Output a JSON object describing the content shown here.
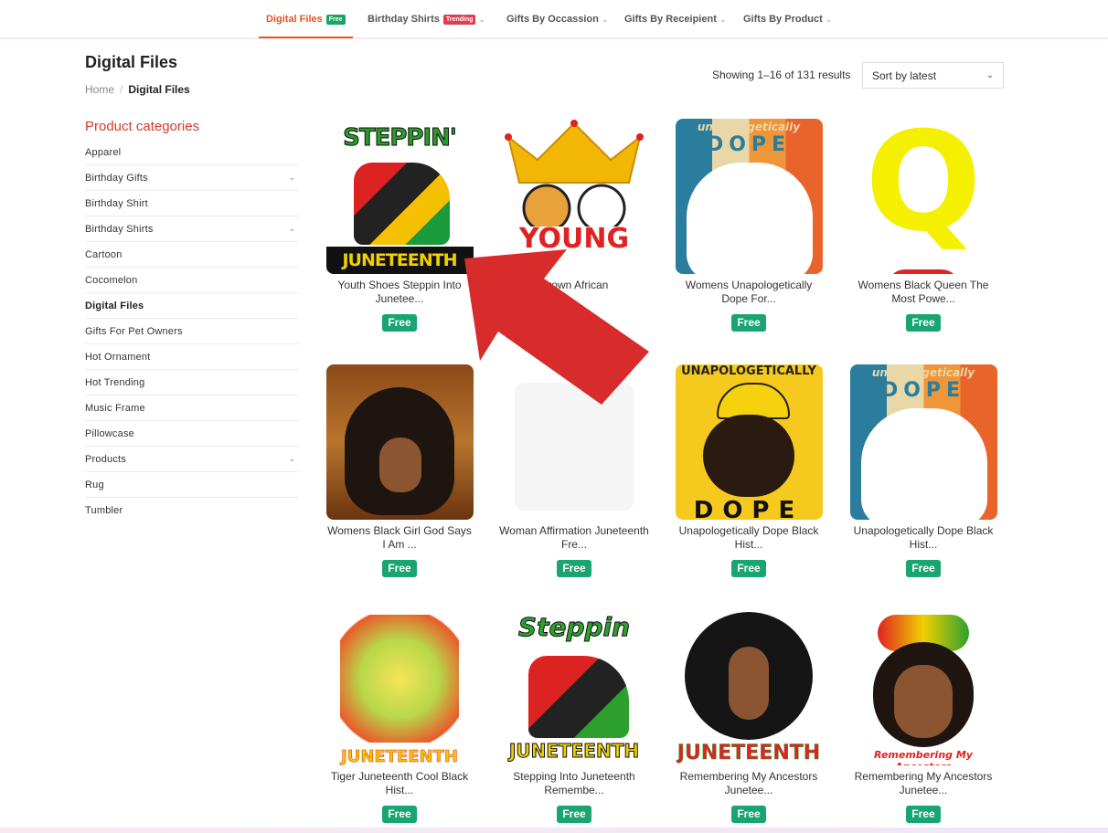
{
  "nav": {
    "items": [
      {
        "label": "Digital Files",
        "badge": "Free",
        "badge_color": "#19a463",
        "active": true
      },
      {
        "label": "Birthday Shirts",
        "badge": "Trending",
        "badge_color": "#e23c4f"
      },
      {
        "label": "Gifts By Occassion"
      },
      {
        "label": "Gifts By Receipient"
      },
      {
        "label": "Gifts By Product"
      }
    ]
  },
  "page": {
    "title": "Digital Files",
    "breadcrumb": {
      "home": "Home",
      "sep": "/",
      "current": "Digital Files"
    },
    "result_count": "Showing 1–16 of 131 results",
    "sort": "Sort by latest"
  },
  "sidebar": {
    "title": "Product categories",
    "items": [
      {
        "label": "Apparel",
        "expandable": false
      },
      {
        "label": "Birthday Gifts",
        "expandable": true
      },
      {
        "label": "Birthday Shirt",
        "expandable": false
      },
      {
        "label": "Birthday Shirts",
        "expandable": true
      },
      {
        "label": "Cartoon",
        "expandable": false
      },
      {
        "label": "Cocomelon",
        "expandable": false
      },
      {
        "label": "Digital Files",
        "expandable": false,
        "current": true
      },
      {
        "label": "Gifts For Pet Owners",
        "expandable": false
      },
      {
        "label": "Hot Ornament",
        "expandable": false
      },
      {
        "label": "Hot Trending",
        "expandable": false
      },
      {
        "label": "Music Frame",
        "expandable": false
      },
      {
        "label": "Pillowcase",
        "expandable": false
      },
      {
        "label": "Products",
        "expandable": true
      },
      {
        "label": "Rug",
        "expandable": false
      },
      {
        "label": "Tumbler",
        "expandable": false
      }
    ]
  },
  "products": [
    {
      "name": "Youth Shoes Steppin Into Junetee...",
      "price": "Free",
      "art": "STEPPIN'",
      "art2": "JUNETEENTH"
    },
    {
      "name": "Crown African",
      "price": "Free",
      "art": "YOUNG",
      "art2": ""
    },
    {
      "name": "Womens Unapologetically Dope For...",
      "price": "Free",
      "art": "unapologetically",
      "art2": "DOPE"
    },
    {
      "name": "Womens Black Queen The Most Powe...",
      "price": "Free",
      "art": "Q",
      "art2": ""
    },
    {
      "name": "Womens Black Girl God Says I Am ...",
      "price": "Free",
      "art": "",
      "art2": ""
    },
    {
      "name": "Woman Affirmation Juneteenth Fre...",
      "price": "Free",
      "art": "",
      "art2": ""
    },
    {
      "name": "Unapologetically Dope Black Hist...",
      "price": "Free",
      "art": "UNAPOLOGETICALLY",
      "art2": "DOPE"
    },
    {
      "name": "Unapologetically Dope Black Hist...",
      "price": "Free",
      "art": "unapologetically",
      "art2": "DOPE"
    },
    {
      "name": "Tiger Juneteenth Cool Black Hist...",
      "price": "Free",
      "art": "",
      "art2": "JUNETEENTH"
    },
    {
      "name": "Stepping Into Juneteenth Remembe...",
      "price": "Free",
      "art": "Steppin",
      "art2": "JUNETEENTH"
    },
    {
      "name": "Remembering My Ancestors Junetee...",
      "price": "Free",
      "art": "",
      "art2": "JUNETEENTH"
    },
    {
      "name": "Remembering My Ancestors Junetee...",
      "price": "Free",
      "art": "",
      "art2": "Remembering My Ancestors"
    }
  ],
  "colors": {
    "accent": "#e8531f",
    "sidebar_title": "#d33a2c",
    "price_badge": "#18a571",
    "arrow": "#d82b2b"
  }
}
